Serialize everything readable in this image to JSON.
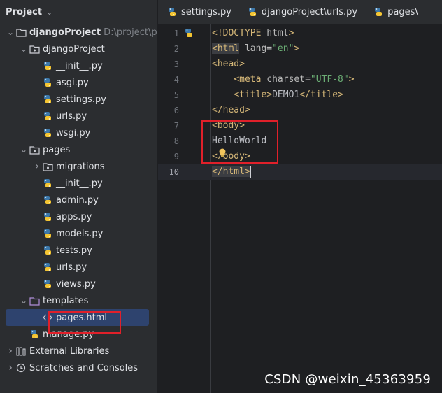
{
  "panel": {
    "title": "Project"
  },
  "tree": [
    {
      "label": "djangoProject",
      "extra": "D:\\project\\pyt",
      "kind": "folder",
      "depth": 0,
      "arrow": "down",
      "bold": true
    },
    {
      "label": "djangoProject",
      "kind": "package",
      "depth": 1,
      "arrow": "down"
    },
    {
      "label": "__init__.py",
      "kind": "python",
      "depth": 2
    },
    {
      "label": "asgi.py",
      "kind": "python",
      "depth": 2
    },
    {
      "label": "settings.py",
      "kind": "python",
      "depth": 2
    },
    {
      "label": "urls.py",
      "kind": "python",
      "depth": 2
    },
    {
      "label": "wsgi.py",
      "kind": "python",
      "depth": 2
    },
    {
      "label": "pages",
      "kind": "package",
      "depth": 1,
      "arrow": "down"
    },
    {
      "label": "migrations",
      "kind": "package",
      "depth": 2,
      "arrow": "right"
    },
    {
      "label": "__init__.py",
      "kind": "python",
      "depth": 2
    },
    {
      "label": "admin.py",
      "kind": "python",
      "depth": 2
    },
    {
      "label": "apps.py",
      "kind": "python",
      "depth": 2
    },
    {
      "label": "models.py",
      "kind": "python",
      "depth": 2
    },
    {
      "label": "tests.py",
      "kind": "python",
      "depth": 2
    },
    {
      "label": "urls.py",
      "kind": "python",
      "depth": 2
    },
    {
      "label": "views.py",
      "kind": "python",
      "depth": 2
    },
    {
      "label": "templates",
      "kind": "template-folder",
      "depth": 1,
      "arrow": "down"
    },
    {
      "label": "pages.html",
      "kind": "html",
      "depth": 2,
      "selected": true
    },
    {
      "label": "manage.py",
      "kind": "python",
      "depth": 1
    },
    {
      "label": "External Libraries",
      "kind": "libraries",
      "depth": 0,
      "arrow": "right"
    },
    {
      "label": "Scratches and Consoles",
      "kind": "scratches",
      "depth": 0,
      "arrow": "right"
    }
  ],
  "tabs": [
    {
      "label": "settings.py",
      "icon": "python-file-icon"
    },
    {
      "label": "djangoProject\\urls.py",
      "icon": "python-file-icon"
    },
    {
      "label": "pages\\",
      "icon": "python-file-icon"
    }
  ],
  "code_lines": [
    {
      "n": "1",
      "parts": [
        [
          "tag",
          "<!DOCTYPE "
        ],
        [
          "attr",
          "html"
        ],
        [
          "tag",
          ">"
        ]
      ]
    },
    {
      "n": "2",
      "parts": [
        [
          "tag hl",
          "<html"
        ],
        [
          "attr",
          " lang="
        ],
        [
          "str",
          "\"en\""
        ],
        [
          "tag",
          ">"
        ]
      ]
    },
    {
      "n": "3",
      "parts": [
        [
          "tag",
          "<head>"
        ]
      ]
    },
    {
      "n": "4",
      "parts": [
        [
          "txt",
          "    "
        ],
        [
          "tag",
          "<meta "
        ],
        [
          "attr",
          "charset="
        ],
        [
          "str",
          "\"UTF-8\""
        ],
        [
          "tag",
          ">"
        ]
      ]
    },
    {
      "n": "5",
      "parts": [
        [
          "txt",
          "    "
        ],
        [
          "tag",
          "<title>"
        ],
        [
          "txt",
          "DEMO1"
        ],
        [
          "tag",
          "</title>"
        ]
      ]
    },
    {
      "n": "6",
      "parts": [
        [
          "tag",
          "</head>"
        ]
      ]
    },
    {
      "n": "7",
      "parts": [
        [
          "tag",
          "<body>"
        ]
      ]
    },
    {
      "n": "8",
      "parts": [
        [
          "txt",
          "HelloWorld"
        ]
      ]
    },
    {
      "n": "9",
      "parts": [
        [
          "tag",
          "</body>"
        ]
      ]
    },
    {
      "n": "10",
      "parts": [
        [
          "tag hl",
          "</html>"
        ]
      ],
      "current": true
    }
  ],
  "watermark": "CSDN @weixin_45363959"
}
